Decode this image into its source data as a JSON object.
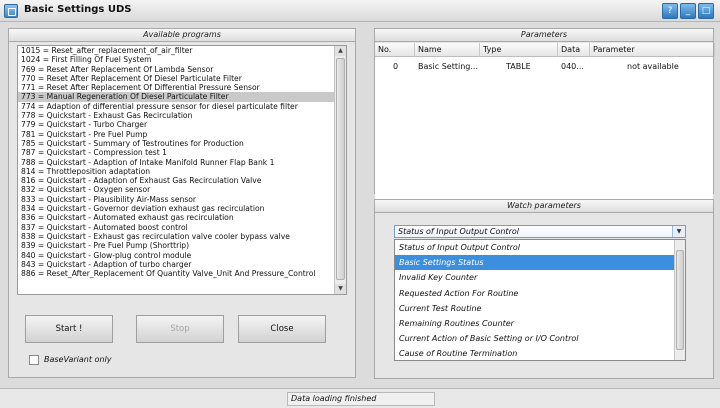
{
  "window": {
    "title": "Basic Settings UDS"
  },
  "programs": {
    "header": "Available programs",
    "items": [
      "1015 = Reset_after_replacement_of_air_filter",
      "1024 = First Filling Of Fuel System",
      "769 = Reset After Replacement Of Lambda Sensor",
      "770 = Reset After Replacement Of Diesel Particulate Filter",
      "771 = Reset After Replacement Of Differential Pressure Sensor",
      "773 = Manual Regeneration Of Diesel Particulate Filter",
      "774 = Adaption of differential pressure sensor for diesel particulate filter",
      "778 = Quickstart - Exhaust Gas Recirculation",
      "779 = Quickstart - Turbo Charger",
      "781 = Quickstart - Pre Fuel Pump",
      "785 = Quickstart - Summary of Testroutines for Production",
      "787 = Quickstart - Compression test 1",
      "788 = Quickstart - Adaption of Intake Manifold Runner Flap Bank 1",
      "814 = Throttleposition adaptation",
      "816 = Quickstart - Adaption of Exhaust Gas Recirculation Valve",
      "832 = Quickstart - Oxygen sensor",
      "833 = Quickstart - Plausibility Air-Mass sensor",
      "834 = Quickstart - Governor deviation exhaust gas recirculation",
      "836 = Quickstart - Automated exhaust gas recirculation",
      "837 = Quickstart - Automated boost control",
      "838 = Quickstart - Exhaust gas recirculation valve cooler bypass valve",
      "839 = Quickstart - Pre Fuel Pump (Shorttrip)",
      "840 = Quickstart - Glow-plug control module",
      "843 = Quickstart - Adaption of turbo charger",
      "886 = Reset_After_Replacement Of Quantity Valve_Unit And Pressure_Control"
    ],
    "selected_index": 5
  },
  "buttons": {
    "start": "Start !",
    "stop": "Stop",
    "close": "Close"
  },
  "checkbox": {
    "label": "BaseVariant only",
    "checked": false
  },
  "parameters": {
    "header": "Parameters",
    "columns": [
      "No.",
      "Name",
      "Type",
      "Data",
      "Parameter"
    ],
    "rows": [
      [
        "0",
        "Basic Setting...",
        "TABLE",
        "040...",
        "not available"
      ]
    ]
  },
  "watch": {
    "header": "Watch parameters",
    "selected": "Status of Input Output Control",
    "options": [
      "Status of Input Output Control",
      "Basic Settings Status",
      "Invalid Key Counter",
      "Requested Action For Routine",
      "Current Test Routine",
      "Remaining Routines Counter",
      "Current Action of Basic Setting or I/O Control",
      "Cause of Routine Termination"
    ],
    "highlighted_index": 1
  },
  "status": {
    "text": "Data loading finished"
  }
}
